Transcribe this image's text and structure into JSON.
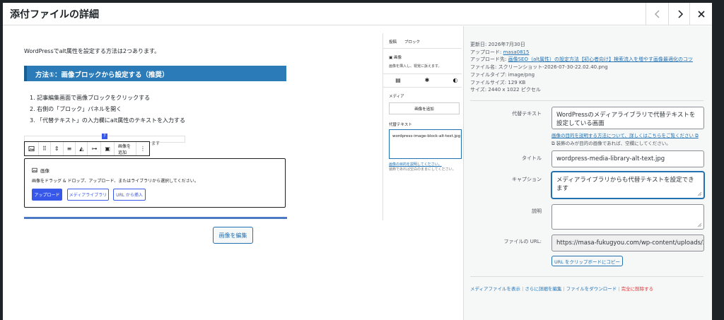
{
  "modal": {
    "title": "添付ファイルの詳細",
    "nav": {
      "prev": "previous-icon",
      "next": "next-icon",
      "close": "close-icon"
    }
  },
  "preview": {
    "intro": "WordPressでalt属性を設定する方法は2つあります。",
    "heading": "方法①：画像ブロックから設定する（推奨）",
    "steps": [
      "1.  記事編集画面で画像ブロックをクリックする",
      "2.  右側の「ブロック」パネルを開く",
      "3.  「代替テキスト」の入力欄にalt属性のテキストを入力する"
    ],
    "suffix_text": "ます",
    "toolbar_add_image": "画像を追加",
    "image_block": {
      "title": "画像",
      "description": "画像をドラッグ & ドロップ、アップロード、またはライブラリから選択してください。",
      "upload": "アップロード",
      "media_library": "メディアライブラリ",
      "insert_url": "URL から挿入"
    },
    "inner_sidebar": {
      "tab_post": "投稿",
      "tab_block": "ブロック",
      "block_name": "画像",
      "block_desc": "画像を挿入し、視覚に訴えます。",
      "media_label": "メディア",
      "add_image": "画像を追加",
      "alt_label": "代替テキスト",
      "alt_value": "wordpress-image-block-alt-text.jpg",
      "alt_link": "画像の目的を説明してください。",
      "alt_note": "装飾であれば空白のままにしてください。"
    },
    "edit_image_button": "画像を編集"
  },
  "details": {
    "uploaded_on": "更新日: 2026年7月30日",
    "uploaded_by_label": "アップロード: ",
    "uploaded_by": "masa0815",
    "uploaded_to_label": "アップロード先: ",
    "uploaded_to": "画像SEO（alt属性）の設定方法【初心者向け】検索流入を増やす画像最適化のコツ",
    "file_name": "ファイル名: スクリーンショット-2026-07-30-22.02.40.png",
    "file_type": "ファイルタイプ: image/png",
    "file_size": "ファイルサイズ: 129 KB",
    "dimensions": "サイズ: 2440 x 1022 ピクセル"
  },
  "form": {
    "alt_label": "代替テキスト",
    "alt_value": "WordPressのメディアライブラリで代替テキストを設定している画面",
    "alt_help_link": "画像の目的を説明する方法について、詳しくはこちらをご覧ください",
    "alt_help_note": "装飾のみが目的の画像であれば、空欄にしてください。",
    "title_label": "タイトル",
    "title_value": "wordpress-media-library-alt-text.jpg",
    "caption_label": "キャプション",
    "caption_value": "メディアライブラリからも代替テキストを設定できます",
    "description_label": "説明",
    "description_value": "",
    "url_label": "ファイルの URL:",
    "url_value": "https://masa-fukugyou.com/wp-content/uploads/20",
    "copy_button": "URL をクリップボードにコピー"
  },
  "actions": {
    "view": "メディアファイルを表示",
    "edit_more": "さらに詳細を編集",
    "download": "ファイルをダウンロード",
    "delete": "完全に削除する",
    "separator": "|"
  },
  "colors": {
    "accent": "#2271b1",
    "danger": "#d63638",
    "heading_bar": "#2b7bb9",
    "wp_blue": "#3858e9"
  }
}
